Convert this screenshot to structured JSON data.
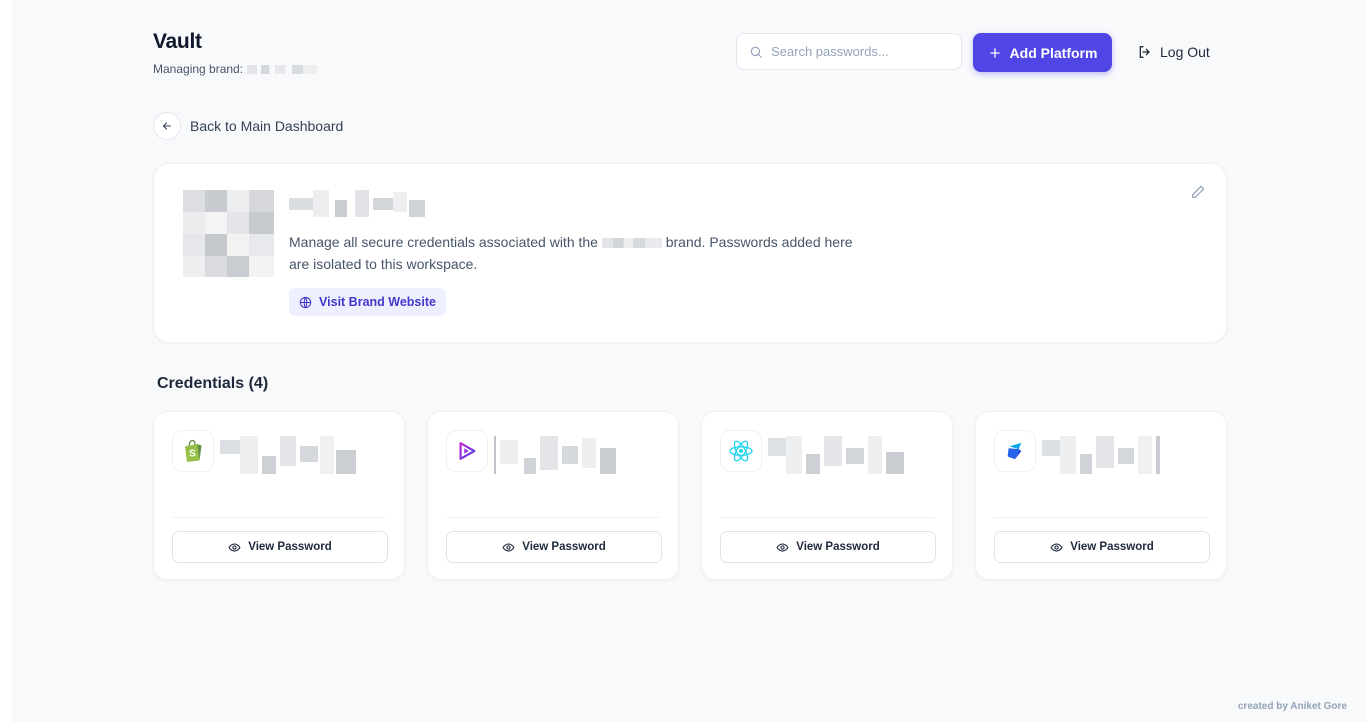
{
  "header": {
    "title": "Vault",
    "subtitle_prefix": "Managing brand:",
    "search_placeholder": "Search passwords...",
    "add_button_label": "Add Platform",
    "logout_label": "Log Out"
  },
  "nav": {
    "back_label": "Back to Main Dashboard"
  },
  "brand_card": {
    "description_prefix": "Manage all secure credentials associated with the",
    "description_suffix": "brand. Passwords added here are isolated to this workspace.",
    "visit_button_label": "Visit Brand Website"
  },
  "credentials": {
    "title": "Credentials (4)",
    "items": [
      {
        "icon": "shopify-icon",
        "button_label": "View Password"
      },
      {
        "icon": "play-icon",
        "button_label": "View Password"
      },
      {
        "icon": "react-icon",
        "button_label": "View Password"
      },
      {
        "icon": "zoho-icon",
        "button_label": "View Password"
      }
    ]
  },
  "colors": {
    "accent": "#4f46e5",
    "background": "#f8f9fb"
  },
  "footer": {
    "credit": "created by Aniket Gore"
  }
}
